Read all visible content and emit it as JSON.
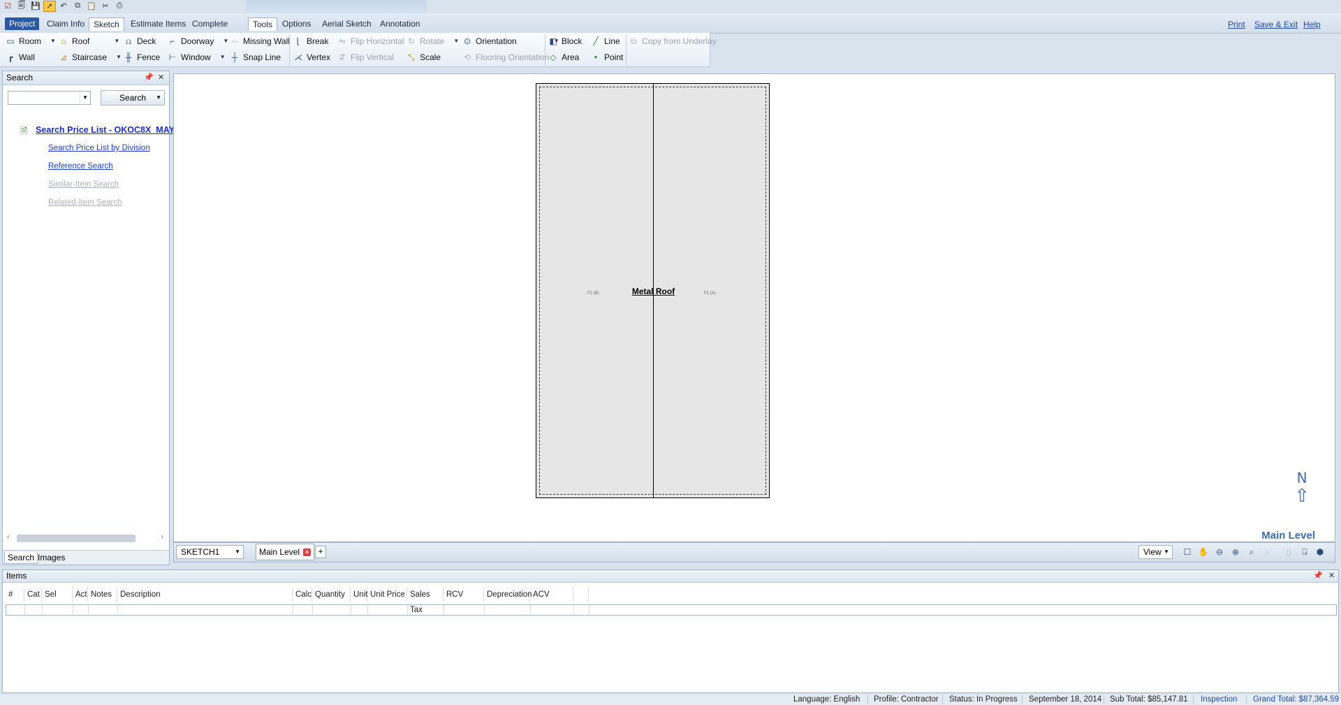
{
  "quick_access": {
    "icons": [
      "checklist-icon",
      "open-icon",
      "save-icon",
      "select-pointer-icon",
      "undo-icon",
      "copy-icon",
      "paste-icon",
      "cut-icon",
      "print-preview-icon"
    ]
  },
  "tabs": {
    "project": "Project",
    "claim_info": "Claim Info",
    "sketch": "Sketch",
    "estimate_items": "Estimate Items",
    "complete": "Complete",
    "tools": "Tools",
    "options": "Options",
    "aerial_sketch": "Aerial Sketch",
    "annotation": "Annotation"
  },
  "top_links": {
    "print": "Print",
    "save_exit": "Save & Exit",
    "help": "Help"
  },
  "ribbon": {
    "room": "Room",
    "roof": "Roof",
    "deck": "Deck",
    "doorway": "Doorway",
    "missing_wall": "Missing Wall",
    "wall": "Wall",
    "staircase": "Staircase",
    "fence": "Fence",
    "window": "Window",
    "snap_line": "Snap Line",
    "break": "Break",
    "flip_horizontal": "Flip Horizontal",
    "rotate": "Rotate",
    "orientation": "Orientation",
    "vertex": "Vertex",
    "flip_vertical": "Flip Vertical",
    "scale": "Scale",
    "flooring_orientation": "Flooring Orientation",
    "block": "Block",
    "line": "Line",
    "area": "Area",
    "point": "Point",
    "copy_from_underlay": "Copy from Underlay"
  },
  "search_panel": {
    "title": "Search",
    "search_button": "Search",
    "combo_value": "",
    "main_link": "Search Price List - OKOC8X_MAY",
    "links": {
      "by_division": "Search Price List by Division",
      "reference": "Reference Search",
      "similar_item": "Similar-Item Search",
      "related_item": "Related-Item Search"
    },
    "bottom_tabs": {
      "search": "Search",
      "images": "Images"
    }
  },
  "canvas": {
    "roof_label": "Metal Roof",
    "facet_left": "F2 (B)",
    "facet_right": "F1 (A)",
    "north": "N",
    "level_name": "Main Level"
  },
  "canvas_bar": {
    "sketch_select": "SKETCH1",
    "level_tab": "Main Level",
    "add_tab": "+",
    "view_select": "View"
  },
  "items_panel": {
    "title": "Items",
    "columns": [
      "#",
      "Cat",
      "Sel",
      "Act",
      "Notes",
      "Description",
      "Calc",
      "Quantity",
      "Unit",
      "Unit Price",
      "Sales Tax",
      "RCV",
      "Depreciation",
      "ACV",
      ""
    ]
  },
  "status_bar": {
    "language": "Language:  English",
    "profile": "Profile:  Contractor",
    "status": "Status:  In Progress",
    "date": "September 18, 2014",
    "subtotal": "Sub Total: $85,147.81",
    "inspection": "Inspection",
    "grand_total": "Grand Total: $87,364.59"
  }
}
